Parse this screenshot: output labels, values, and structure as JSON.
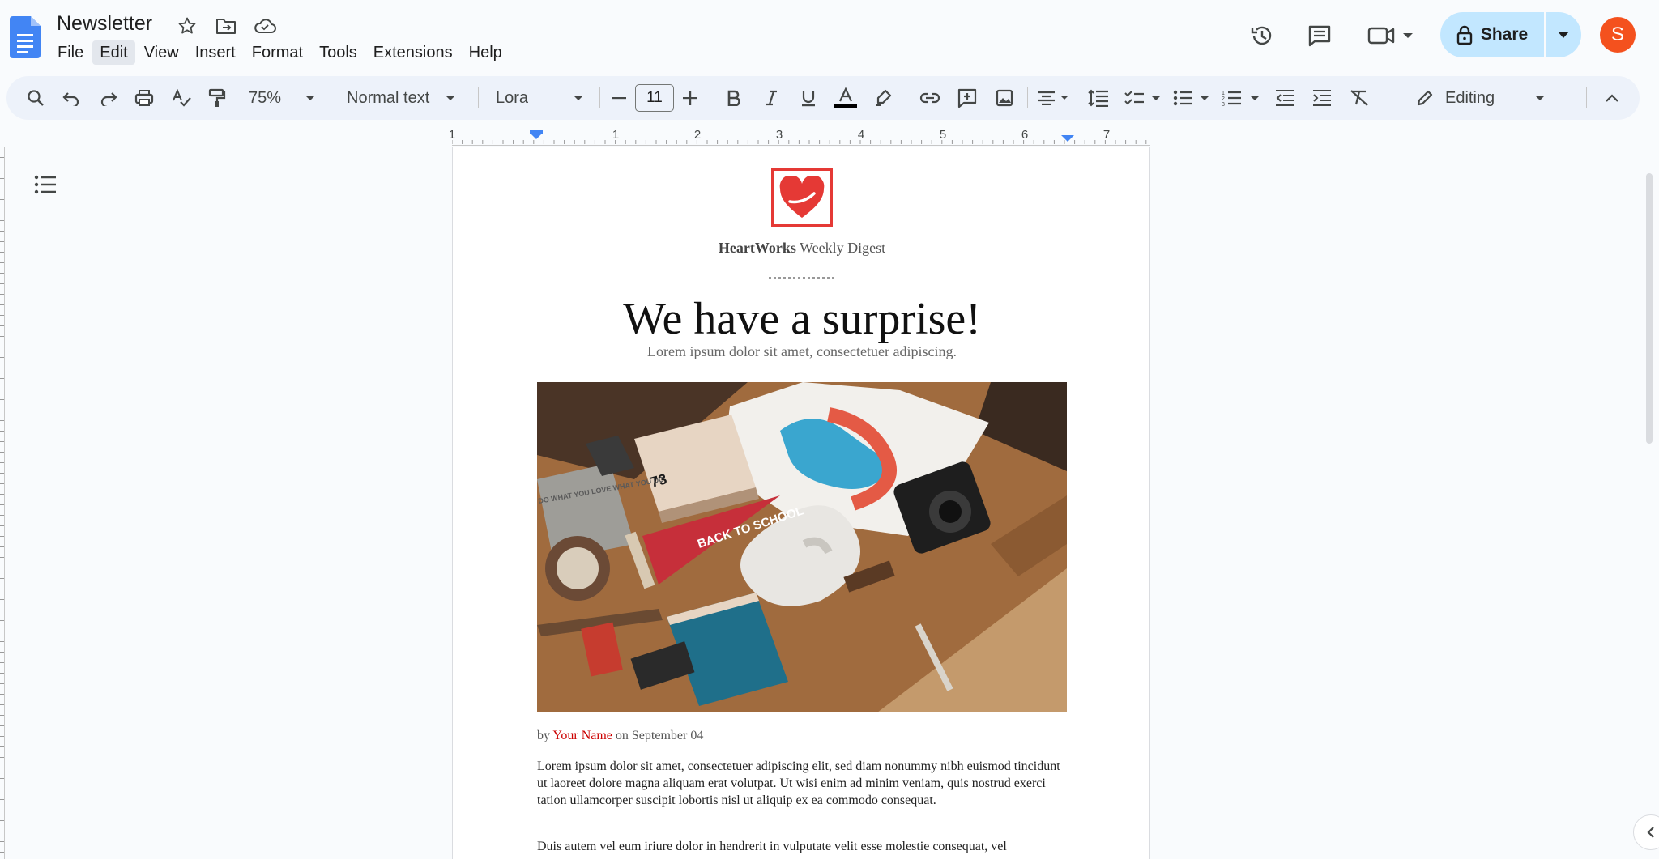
{
  "document": {
    "title": "Newsletter",
    "title_icons": [
      "star-icon",
      "move-folder-icon",
      "cloud-saved-icon"
    ]
  },
  "menu": [
    "File",
    "Edit",
    "View",
    "Insert",
    "Format",
    "Tools",
    "Extensions",
    "Help"
  ],
  "menu_active": "Edit",
  "header_right": {
    "icons": [
      "version-history-icon",
      "comments-icon",
      "meet-camera-icon"
    ],
    "share_label": "Share",
    "avatar_initial": "S",
    "avatar_color": "#f4511e"
  },
  "toolbar": {
    "zoom": "75%",
    "style": "Normal text",
    "font": "Lora",
    "font_size": "11",
    "mode": "Editing",
    "text_color": "#000000"
  },
  "ruler": {
    "numbers": [
      "1",
      "1",
      "2",
      "3",
      "4",
      "5",
      "6",
      "7"
    ]
  },
  "page": {
    "brand_bold": "HeartWorks",
    "brand_rest": " Weekly Digest",
    "headline": "We have a surprise!",
    "subtitle": "Lorem ipsum dolor sit amet, consectetuer adipiscing.",
    "byline_prefix": "by ",
    "author": "Your Name",
    "byline_suffix": " on September 04",
    "paragraph1": "Lorem ipsum dolor sit amet, consectetuer adipiscing elit, sed diam nonummy nibh euismod tincidunt ut laoreet dolore magna aliquam erat volutpat. Ut wisi enim ad minim veniam, quis nostrud exerci tation ullamcorper suscipit lobortis nisl ut aliquip ex ea commodo consequat.",
    "paragraph2": "Duis autem vel eum iriure dolor in hendrerit in vulputate velit esse molestie consequat, vel",
    "photo_texts": [
      "BACK TO SCHOOL",
      "DO WHAT YOU LOVE WHAT YOU DO",
      "73"
    ]
  },
  "colors": {
    "accent": "#c2e7ff",
    "brand_red": "#e53935",
    "docs_blue": "#4285f4"
  }
}
